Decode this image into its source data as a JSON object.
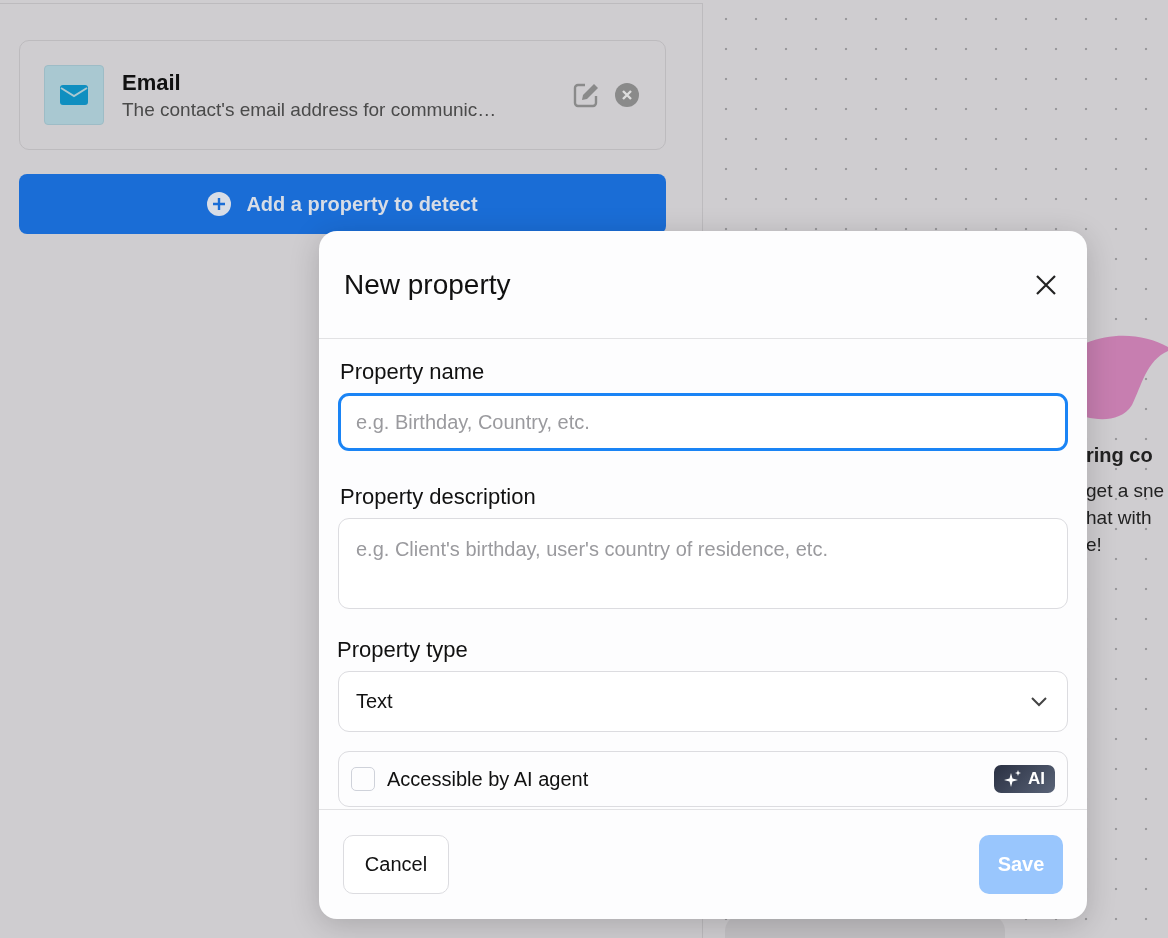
{
  "property_card": {
    "title": "Email",
    "description": "The contact's email address for communic…"
  },
  "add_button": {
    "label": "Add a property to detect"
  },
  "preview_panel": {
    "lines": [
      {
        "kind": "heading",
        "text": "ring co"
      },
      {
        "kind": "body",
        "text": "get a sne"
      },
      {
        "kind": "body",
        "text": "hat with"
      },
      {
        "kind": "body",
        "text": "e!"
      }
    ]
  },
  "dialog": {
    "title": "New property",
    "fields": [
      {
        "kind": "input",
        "label": "Property name",
        "placeholder": "e.g. Birthday, Country, etc.",
        "focused": true
      },
      {
        "kind": "textarea",
        "label": "Property description",
        "placeholder": "e.g. Client's birthday, user's country of residence, etc.",
        "focused": false
      },
      {
        "kind": "select",
        "label": "Property type",
        "value": "Text",
        "focused": false
      }
    ],
    "checkbox": {
      "label": "Accessible by AI agent",
      "checked": false,
      "badge": "AI"
    },
    "buttons": [
      {
        "kind": "secondary",
        "label": "Cancel",
        "disabled": false
      },
      {
        "kind": "primary",
        "label": "Save",
        "disabled": true
      }
    ]
  }
}
